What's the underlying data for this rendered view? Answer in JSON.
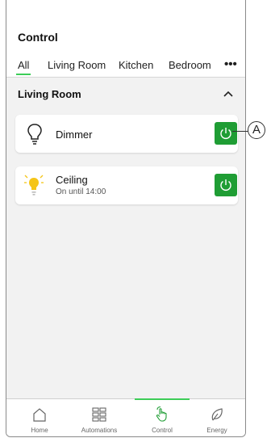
{
  "header": {
    "title": "Control",
    "tabs": [
      {
        "label": "All",
        "active": true
      },
      {
        "label": "Living Room"
      },
      {
        "label": "Kitchen"
      },
      {
        "label": "Bedroom"
      }
    ],
    "more_label": "•••"
  },
  "section": {
    "title": "Living Room",
    "collapse_icon": "chevron-up-icon"
  },
  "devices": [
    {
      "name": "Dimmer",
      "status": "",
      "icon": "lightbulb-outline-icon",
      "power_icon": "power-icon",
      "on": true
    },
    {
      "name": "Ceiling",
      "status": "On until 14:00",
      "icon": "lightbulb-glowing-icon",
      "power_icon": "power-icon",
      "on": true
    }
  ],
  "bottom_nav": [
    {
      "label": "Home",
      "icon": "house-icon"
    },
    {
      "label": "Automations",
      "icon": "grid-icon"
    },
    {
      "label": "Control",
      "icon": "hand-touch-icon",
      "active": true
    },
    {
      "label": "Energy",
      "icon": "leaf-icon"
    }
  ],
  "callout": {
    "label": "A"
  },
  "colors": {
    "accent_green": "#3dcd58",
    "power_button": "#1f9d34",
    "bulb_yellow": "#f5c518",
    "background": "#f2f2f2"
  }
}
